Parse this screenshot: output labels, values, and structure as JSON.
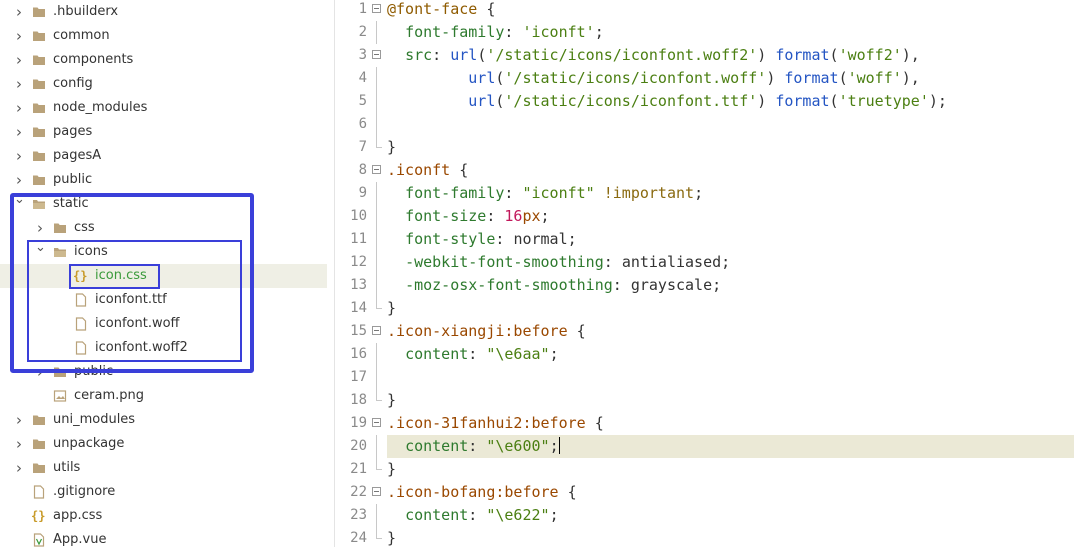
{
  "sidebar": {
    "items": [
      {
        "label": ".hbuilderx",
        "type": "folder",
        "expanded": false
      },
      {
        "label": "common",
        "type": "folder",
        "expanded": false
      },
      {
        "label": "components",
        "type": "folder",
        "expanded": false
      },
      {
        "label": "config",
        "type": "folder",
        "expanded": false
      },
      {
        "label": "node_modules",
        "type": "folder",
        "expanded": false
      },
      {
        "label": "pages",
        "type": "folder",
        "expanded": false
      },
      {
        "label": "pagesA",
        "type": "folder",
        "expanded": false
      },
      {
        "label": "public",
        "type": "folder",
        "expanded": false
      },
      {
        "label": "static",
        "type": "folder",
        "expanded": true
      },
      {
        "label": "css",
        "type": "folder",
        "expanded": false
      },
      {
        "label": "icons",
        "type": "folder",
        "expanded": true
      },
      {
        "label": "icon.css",
        "type": "css-file",
        "selected": true
      },
      {
        "label": "iconfont.ttf",
        "type": "file"
      },
      {
        "label": "iconfont.woff",
        "type": "file"
      },
      {
        "label": "iconfont.woff2",
        "type": "file"
      },
      {
        "label": "public",
        "type": "folder",
        "expanded": false
      },
      {
        "label": "ceram.png",
        "type": "image-file"
      },
      {
        "label": "uni_modules",
        "type": "folder",
        "expanded": false
      },
      {
        "label": "unpackage",
        "type": "folder",
        "expanded": false
      },
      {
        "label": "utils",
        "type": "folder",
        "expanded": false
      },
      {
        "label": ".gitignore",
        "type": "file"
      },
      {
        "label": "app.css",
        "type": "css-file"
      },
      {
        "label": "App.vue",
        "type": "vue-file"
      }
    ]
  },
  "editor": {
    "current_line": 20,
    "lines": [
      {
        "n": "1",
        "fold": "open",
        "tokens": [
          [
            "at",
            "@font-face"
          ],
          [
            "punc",
            " {"
          ]
        ]
      },
      {
        "n": "2",
        "fold": "line",
        "tokens": [
          [
            "plain",
            "  "
          ],
          [
            "prop",
            "font-family"
          ],
          [
            "punc",
            ": "
          ],
          [
            "str",
            "'iconft'"
          ],
          [
            "punc",
            ";"
          ]
        ]
      },
      {
        "n": "3",
        "fold": "open",
        "tokens": [
          [
            "plain",
            "  "
          ],
          [
            "prop",
            "src"
          ],
          [
            "punc",
            ": "
          ],
          [
            "func",
            "url"
          ],
          [
            "punc",
            "("
          ],
          [
            "str",
            "'/static/icons/iconfont.woff2'"
          ],
          [
            "punc",
            ") "
          ],
          [
            "func",
            "format"
          ],
          [
            "punc",
            "("
          ],
          [
            "str",
            "'woff2'"
          ],
          [
            "punc",
            "),"
          ]
        ]
      },
      {
        "n": "4",
        "fold": "line",
        "tokens": [
          [
            "plain",
            "         "
          ],
          [
            "func",
            "url"
          ],
          [
            "punc",
            "("
          ],
          [
            "str",
            "'/static/icons/iconfont.woff'"
          ],
          [
            "punc",
            ") "
          ],
          [
            "func",
            "format"
          ],
          [
            "punc",
            "("
          ],
          [
            "str",
            "'woff'"
          ],
          [
            "punc",
            "),"
          ]
        ]
      },
      {
        "n": "5",
        "fold": "line",
        "tokens": [
          [
            "plain",
            "         "
          ],
          [
            "func",
            "url"
          ],
          [
            "punc",
            "("
          ],
          [
            "str",
            "'/static/icons/iconfont.ttf'"
          ],
          [
            "punc",
            ") "
          ],
          [
            "func",
            "format"
          ],
          [
            "punc",
            "("
          ],
          [
            "str",
            "'truetype'"
          ],
          [
            "punc",
            ");"
          ]
        ]
      },
      {
        "n": "6",
        "fold": "line",
        "tokens": []
      },
      {
        "n": "7",
        "fold": "end",
        "tokens": [
          [
            "punc",
            "}"
          ]
        ]
      },
      {
        "n": "8",
        "fold": "open",
        "tokens": [
          [
            "sel",
            ".iconft"
          ],
          [
            "punc",
            " {"
          ]
        ]
      },
      {
        "n": "9",
        "fold": "line",
        "tokens": [
          [
            "plain",
            "  "
          ],
          [
            "prop",
            "font-family"
          ],
          [
            "punc",
            ": "
          ],
          [
            "str",
            "\"iconft\""
          ],
          [
            "plain",
            " "
          ],
          [
            "imp",
            "!important"
          ],
          [
            "punc",
            ";"
          ]
        ]
      },
      {
        "n": "10",
        "fold": "line",
        "tokens": [
          [
            "plain",
            "  "
          ],
          [
            "prop",
            "font-size"
          ],
          [
            "punc",
            ": "
          ],
          [
            "num",
            "16"
          ],
          [
            "tokpx",
            "px"
          ],
          [
            "punc",
            ";"
          ]
        ]
      },
      {
        "n": "11",
        "fold": "line",
        "tokens": [
          [
            "plain",
            "  "
          ],
          [
            "prop",
            "font-style"
          ],
          [
            "punc",
            ": "
          ],
          [
            "plain",
            "normal"
          ],
          [
            "punc",
            ";"
          ]
        ]
      },
      {
        "n": "12",
        "fold": "line",
        "tokens": [
          [
            "plain",
            "  "
          ],
          [
            "prop",
            "-webkit-font-smoothing"
          ],
          [
            "punc",
            ": "
          ],
          [
            "plain",
            "antialiased"
          ],
          [
            "punc",
            ";"
          ]
        ]
      },
      {
        "n": "13",
        "fold": "line",
        "tokens": [
          [
            "plain",
            "  "
          ],
          [
            "prop",
            "-moz-osx-font-smoothing"
          ],
          [
            "punc",
            ": "
          ],
          [
            "plain",
            "grayscale"
          ],
          [
            "punc",
            ";"
          ]
        ]
      },
      {
        "n": "14",
        "fold": "end",
        "tokens": [
          [
            "punc",
            "}"
          ]
        ]
      },
      {
        "n": "15",
        "fold": "open",
        "tokens": [
          [
            "sel",
            ".icon-xiangji:before"
          ],
          [
            "punc",
            " {"
          ]
        ]
      },
      {
        "n": "16",
        "fold": "line",
        "tokens": [
          [
            "plain",
            "  "
          ],
          [
            "prop",
            "content"
          ],
          [
            "punc",
            ": "
          ],
          [
            "str",
            "\"\\e6aa\""
          ],
          [
            "punc",
            ";"
          ]
        ]
      },
      {
        "n": "17",
        "fold": "line",
        "tokens": []
      },
      {
        "n": "18",
        "fold": "end",
        "tokens": [
          [
            "punc",
            "}"
          ]
        ]
      },
      {
        "n": "19",
        "fold": "open",
        "tokens": [
          [
            "sel",
            ".icon-31fanhui2:before"
          ],
          [
            "punc",
            " {"
          ]
        ]
      },
      {
        "n": "20",
        "fold": "line",
        "tokens": [
          [
            "plain",
            "  "
          ],
          [
            "prop",
            "content"
          ],
          [
            "punc",
            ": "
          ],
          [
            "str",
            "\"\\e600\""
          ],
          [
            "punc",
            ";"
          ]
        ]
      },
      {
        "n": "21",
        "fold": "end",
        "tokens": [
          [
            "punc",
            "}"
          ]
        ]
      },
      {
        "n": "22",
        "fold": "open",
        "tokens": [
          [
            "sel",
            ".icon-bofang:before"
          ],
          [
            "punc",
            " {"
          ]
        ]
      },
      {
        "n": "23",
        "fold": "line",
        "tokens": [
          [
            "plain",
            "  "
          ],
          [
            "prop",
            "content"
          ],
          [
            "punc",
            ": "
          ],
          [
            "str",
            "\"\\e622\""
          ],
          [
            "punc",
            ";"
          ]
        ]
      },
      {
        "n": "24",
        "fold": "end",
        "tokens": [
          [
            "punc",
            "}"
          ]
        ]
      }
    ]
  },
  "colors": {
    "highlight_box": "#3a3fd9",
    "folder_icon": "#b9a27a",
    "selected_row_bg": "#efefe5",
    "current_line_bg": "#ebe9d6"
  }
}
